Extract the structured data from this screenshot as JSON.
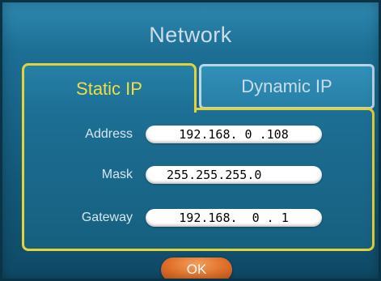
{
  "screen": {
    "title": "Network"
  },
  "tabs": {
    "static_label": "Static IP",
    "dynamic_label": "Dynamic IP",
    "selected": "Static IP"
  },
  "fields": [
    {
      "label": "Address",
      "value": "192.168. 0 .108"
    },
    {
      "label": "Mask",
      "value": "255.255.255.0"
    },
    {
      "label": "Gateway",
      "value": "192.168.  0 . 1"
    }
  ],
  "buttons": {
    "ok_label": "OK"
  },
  "colors": {
    "background": "#1d6f95",
    "selected_tab_border": "#e3d33a",
    "selected_tab_text": "#f0de42",
    "unselected_tab_border": "#b8d7e6",
    "field_background": "#ffffff",
    "ok_button": "#e2712b"
  }
}
